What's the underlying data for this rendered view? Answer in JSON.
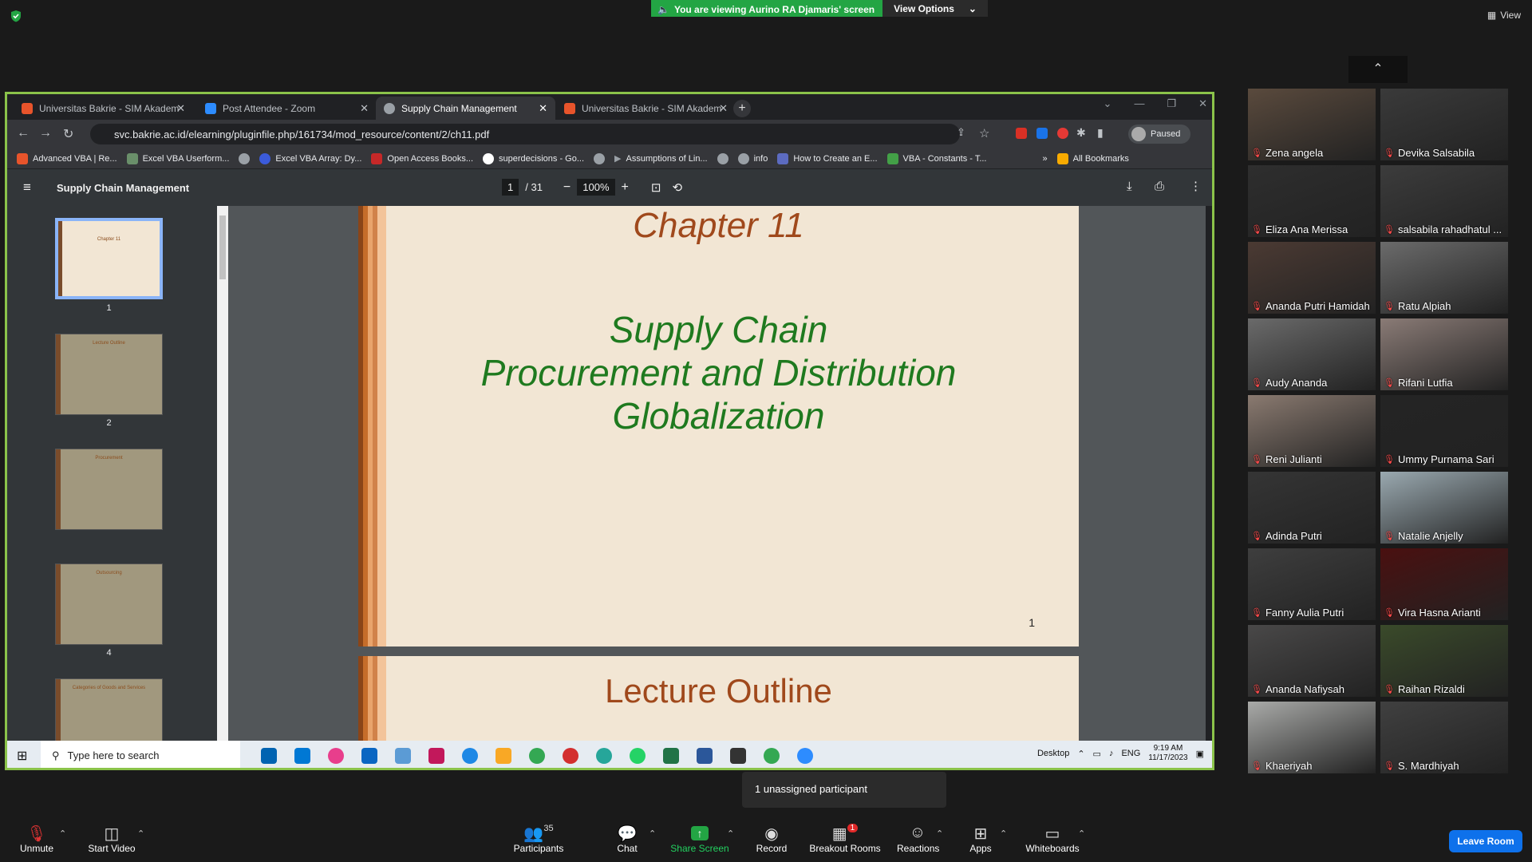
{
  "top": {
    "banner": "You are viewing Aurino RA Djamaris' screen",
    "view_options": "View Options",
    "view": "View"
  },
  "browser": {
    "tabs": [
      {
        "label": "Universitas Bakrie - SIM Akadem",
        "color": "#e8542b"
      },
      {
        "label": "Post Attendee - Zoom",
        "color": "#2d8cff"
      },
      {
        "label": "Supply Chain Management",
        "color": "#9aa0a6"
      },
      {
        "label": "Universitas Bakrie - SIM Akadem",
        "color": "#e8542b"
      }
    ],
    "url": "svc.bakrie.ac.id/elearning/pluginfile.php/161734/mod_resource/content/2/ch11.pdf",
    "profile_status": "Paused",
    "bookmarks": [
      "Advanced VBA | Re...",
      "Excel VBA Userform...",
      "",
      "Excel VBA Array: Dy...",
      "Open Access Books...",
      "superdecisions - Go...",
      "",
      "Assumptions of Lin...",
      "",
      "info",
      "How to Create an E...",
      "VBA - Constants - T..."
    ],
    "bookmarks_more": "»",
    "all_bookmarks": "All Bookmarks"
  },
  "pdf": {
    "title": "Supply Chain Management",
    "page_current": "1",
    "page_total": "/ 31",
    "zoom": "100%",
    "thumb_numbers": [
      "1",
      "2",
      "",
      "4"
    ],
    "thumb_titles": [
      "Chapter 11",
      "Lecture Outline",
      "Procurement",
      "Outsourcing",
      "Categories of Goods and Services"
    ],
    "page1": {
      "chapter": "Chapter 11",
      "line1": "Supply Chain",
      "line2": "Procurement and Distribution",
      "line3": "Globalization",
      "number": "1"
    },
    "page2": {
      "title": "Lecture Outline"
    }
  },
  "taskbar": {
    "search_placeholder": "Type here to search",
    "desktop": "Desktop",
    "lang": "ENG",
    "time": "9:19 AM",
    "date": "11/17/2023"
  },
  "participants": [
    "Zena angela",
    "Devika Salsabila",
    "Eliza Ana Merissa",
    "salsabila rahadhatul ...",
    "Ananda Putri Hamidah",
    "Ratu Alpiah",
    "Audy Ananda",
    "Rifani Lutfia",
    "Reni Julianti",
    "Ummy Purnama Sari",
    "Adinda Putri",
    "Natalie Anjelly",
    "Fanny Aulia Putri",
    "Vira Hasna Arianti",
    "Ananda Nafiysah",
    "Raihan Rizaldi",
    "Khaeriyah",
    "S. Mardhiyah"
  ],
  "tooltip": "1 unassigned participant",
  "toolbar": {
    "unmute": "Unmute",
    "start_video": "Start Video",
    "participants": "Participants",
    "participants_count": "35",
    "chat": "Chat",
    "share_screen": "Share Screen",
    "record": "Record",
    "breakout_rooms": "Breakout Rooms",
    "breakout_badge": "1",
    "reactions": "Reactions",
    "apps": "Apps",
    "whiteboards": "Whiteboards",
    "leave": "Leave Room"
  },
  "colors": {
    "accent_green": "#23a544",
    "share_border": "#8bc34a",
    "leave_blue": "#0e71eb"
  }
}
